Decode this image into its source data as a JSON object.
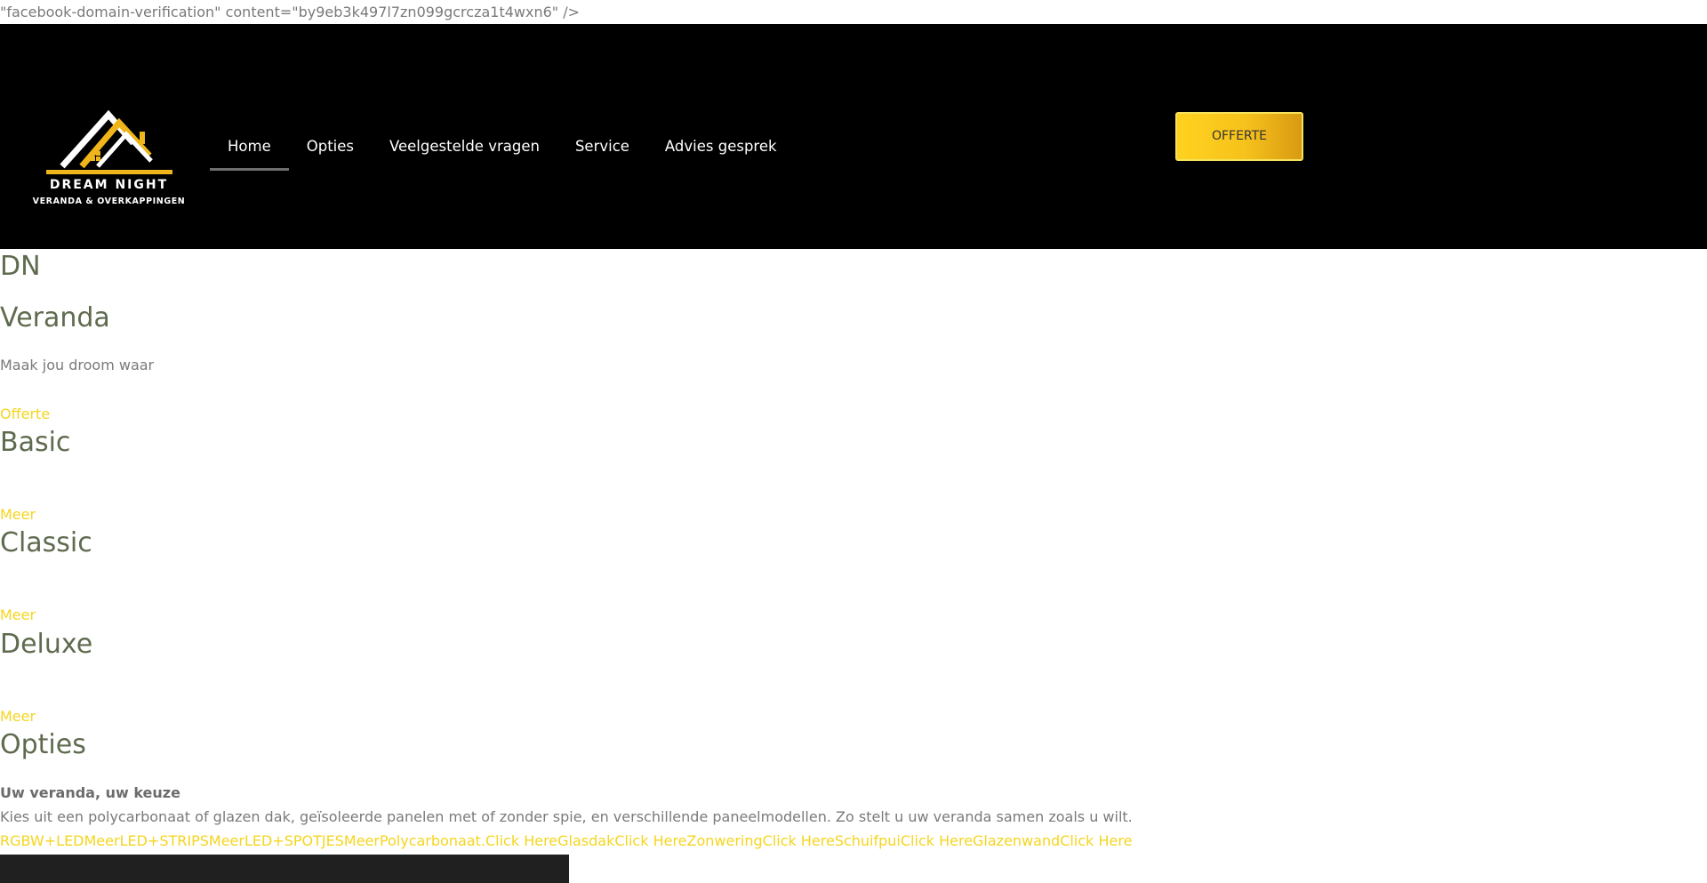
{
  "snippet": "\"facebook-domain-verification\" content=\"by9eb3k497l7zn099gcrcza1t4wxn6\" />",
  "logo": {
    "title": "DREAM NIGHT",
    "subtitle": "VERANDA & OVERKAPPINGEN",
    "accent": "#f0b51a"
  },
  "nav": {
    "items": [
      {
        "label": "Home",
        "active": true
      },
      {
        "label": "Opties"
      },
      {
        "label": "Veelgestelde vragen"
      },
      {
        "label": "Service"
      },
      {
        "label": "Advies gesprek"
      }
    ]
  },
  "header": {
    "cta_label": "OFFERTE"
  },
  "hero": {
    "line1": "DN",
    "line2": "Veranda",
    "tagline": "Maak jou droom waar",
    "cta": "Offerte"
  },
  "packages": [
    {
      "title": "Basic",
      "link": "Meer"
    },
    {
      "title": "Classic",
      "link": "Meer"
    },
    {
      "title": "Deluxe",
      "link": "Meer"
    }
  ],
  "options": {
    "title": "Opties",
    "subtitle": "Uw veranda, uw keuze",
    "description": "Kies uit een polycarbonaat of glazen dak, geïsoleerde panelen met of zonder spie, en verschillende paneelmodellen. Zo stelt u uw veranda samen zoals u wilt.",
    "links": [
      "RGBW+LED",
      "Meer",
      "LED+STRIPS",
      "Meer",
      "LED+SPOTJES",
      "Meer",
      "Polycarbonaat.",
      "Click Here",
      "Glasdak",
      "Click Here",
      "Zonwering",
      "Click Here",
      "Schuifpui",
      "Click Here",
      "Glazenwand",
      "Click Here"
    ]
  }
}
